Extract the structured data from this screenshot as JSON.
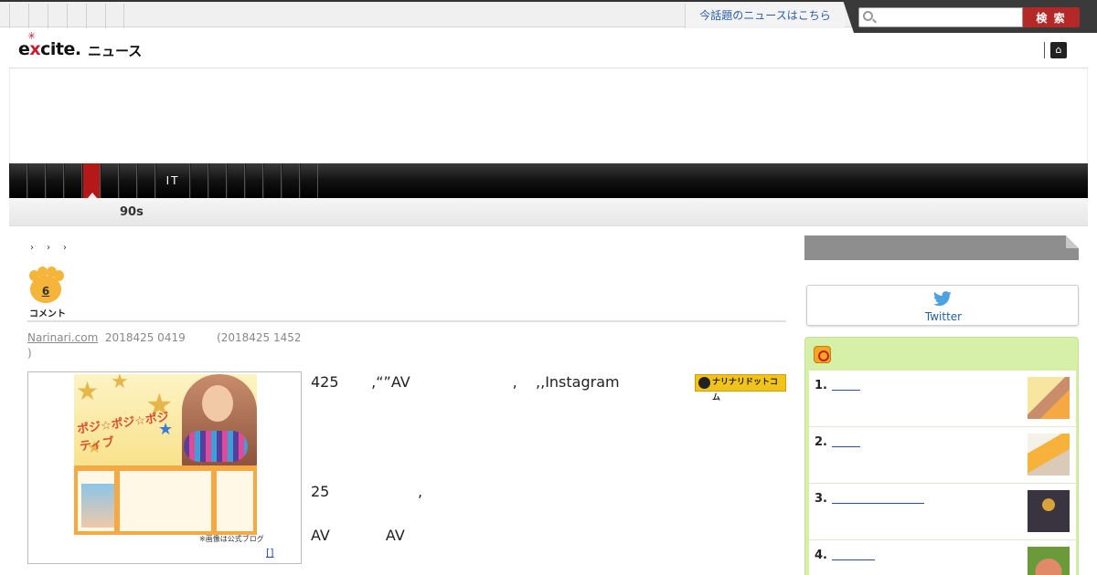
{
  "topbar": {
    "hot_news_link": "今話題のニュースはこちら",
    "search_placeholder": "",
    "search_button": "検 索"
  },
  "header": {
    "logo_text_e": "e",
    "logo_text_x": "x",
    "logo_text_rest": "cite",
    "logo_sub": "ニュース",
    "home_glyph": "⌂"
  },
  "catnav": {
    "items": [
      "",
      "",
      "",
      "",
      "",
      "",
      "",
      "",
      "IT",
      "",
      "",
      "",
      "",
      "",
      "",
      ""
    ],
    "active_index": 4
  },
  "subnav": {
    "tag": "90s"
  },
  "breadcrumb": [
    "›",
    "›",
    "›"
  ],
  "comments": {
    "count": "6",
    "label": "コメント"
  },
  "meta": {
    "source": "Narinari.com",
    "published": "2018425 0419",
    "updated": "(2018425 1452",
    "updated_close": ")"
  },
  "photo": {
    "blog_title": "ポジ☆ポジ☆ポジティブ",
    "caption": "※画像は公式ブログ",
    "link": "[]"
  },
  "body": {
    "line1_a": "425",
    "line1_b": ",“”AV",
    "line1_c": ",",
    "line1_d": ",",
    "line1_e": ",Instagram",
    "line2_a": "25",
    "line2_b": ",",
    "line3_a": "AV",
    "line3_b": "AV"
  },
  "narinari_badge": "ナリナリドットコム",
  "sidebar": {
    "twitter_label": "Twitter",
    "ranking_title": "",
    "ranking": [
      {
        "num": "1.",
        "link": ""
      },
      {
        "num": "2.",
        "link": ""
      },
      {
        "num": "3.",
        "link": ""
      },
      {
        "num": "4.",
        "link": ""
      }
    ]
  },
  "colors": {
    "accent_red": "#b42828",
    "ranking_bg": "#d7f0a8",
    "link_blue": "#2a4cb8"
  }
}
